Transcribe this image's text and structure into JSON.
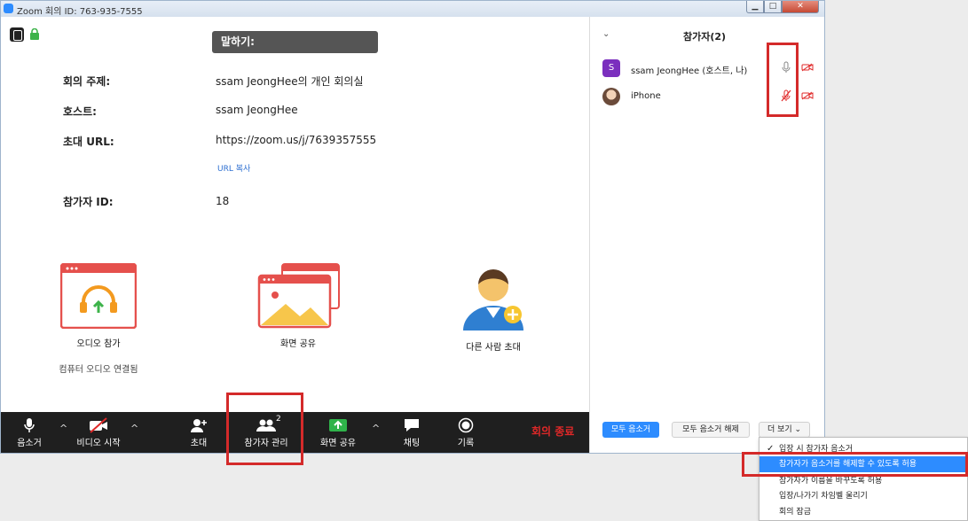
{
  "window": {
    "title": "Zoom 회의 ID: 763-935-7555"
  },
  "speaking": {
    "label": "말하기:"
  },
  "meeting_info": {
    "topic_label": "회의 주제:",
    "topic_value": "ssam JeongHee의 개인 회의실",
    "host_label": "호스트:",
    "host_value": "ssam JeongHee",
    "url_label": "초대 URL:",
    "url_value": "https://zoom.us/j/7639357555",
    "copy_url": "URL 복사",
    "pid_label": "참가자 ID:",
    "pid_value": "18"
  },
  "actions": {
    "audio_label": "오디오 참가",
    "audio_sub": "컴퓨터 오디오 연결됨",
    "share_label": "화면 공유",
    "invite_label": "다른 사람 초대"
  },
  "toolbar": {
    "mute": "음소거",
    "video": "비디오 시작",
    "invite": "초대",
    "participants": "참가자 관리",
    "participants_count": "2",
    "share": "화면 공유",
    "chat": "채팅",
    "record": "기록",
    "end": "회의 종료"
  },
  "panel": {
    "collapse_icon": "chevron-down",
    "title": "참가자(2)",
    "participants": [
      {
        "initial": "S",
        "name": "ssam JeongHee (호스트, 나)",
        "mic": "unmuted",
        "video": "off"
      },
      {
        "initial": "",
        "name": "iPhone",
        "mic": "muted",
        "video": "off"
      }
    ],
    "mute_all": "모두 음소거",
    "unmute_all": "모두 음소거 해제",
    "more": "더 보기 ⌄"
  },
  "dropdown": {
    "items": [
      {
        "label": "입장 시 참가자 음소거",
        "checked": true
      },
      {
        "label": "참가자가 음소거를 해제할 수 있도록 허용",
        "selected": true
      },
      {
        "label": "참가자가 이름을 바꾸도록 허용"
      },
      {
        "label": "입장/나가기 차임벨 울리기"
      },
      {
        "label": "회의 잠금"
      }
    ]
  },
  "colors": {
    "accent": "#2d8cff",
    "highlight_box": "#d42a2a",
    "end": "#e02828"
  }
}
